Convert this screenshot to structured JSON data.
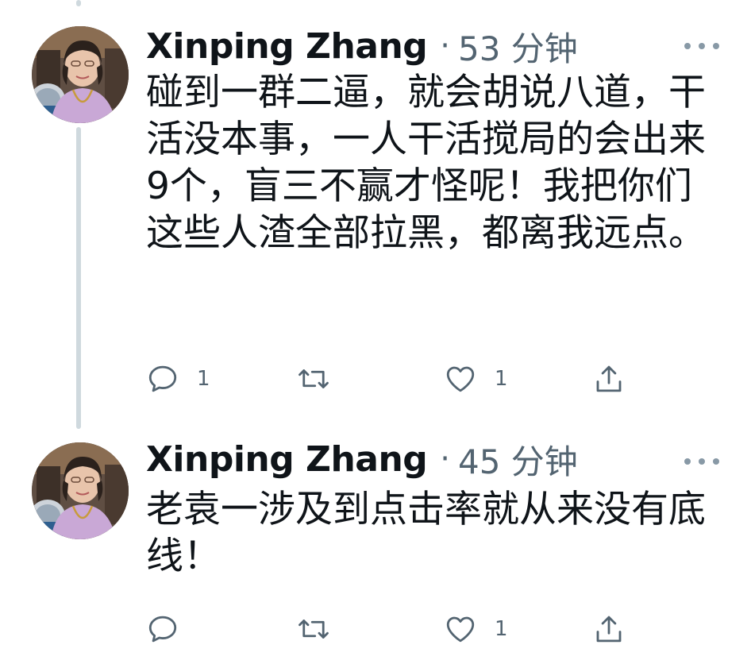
{
  "tweets": [
    {
      "author": "Xinping Zhang",
      "separator": "·",
      "time": "53 分钟",
      "text": "碰到一群二逼，就会胡说八道，干活没本事，一人干活搅局的会出来9个，盲三不赢才怪呢！我把你们这些人渣全部拉黑，都离我远点。",
      "reply_count": "1",
      "retweet_count": "",
      "like_count": "1"
    },
    {
      "author": "Xinping Zhang",
      "separator": "·",
      "time": "45 分钟",
      "text": "老袁一涉及到点击率就从来没有底线！",
      "reply_count": "",
      "retweet_count": "",
      "like_count": "1"
    }
  ],
  "icons": {
    "reply": "reply-icon",
    "retweet": "retweet-icon",
    "like": "like-icon",
    "share": "share-icon",
    "more": "more-icon"
  },
  "colors": {
    "text": "#0f1419",
    "muted": "#536471",
    "thread_line": "#cfd9de"
  }
}
